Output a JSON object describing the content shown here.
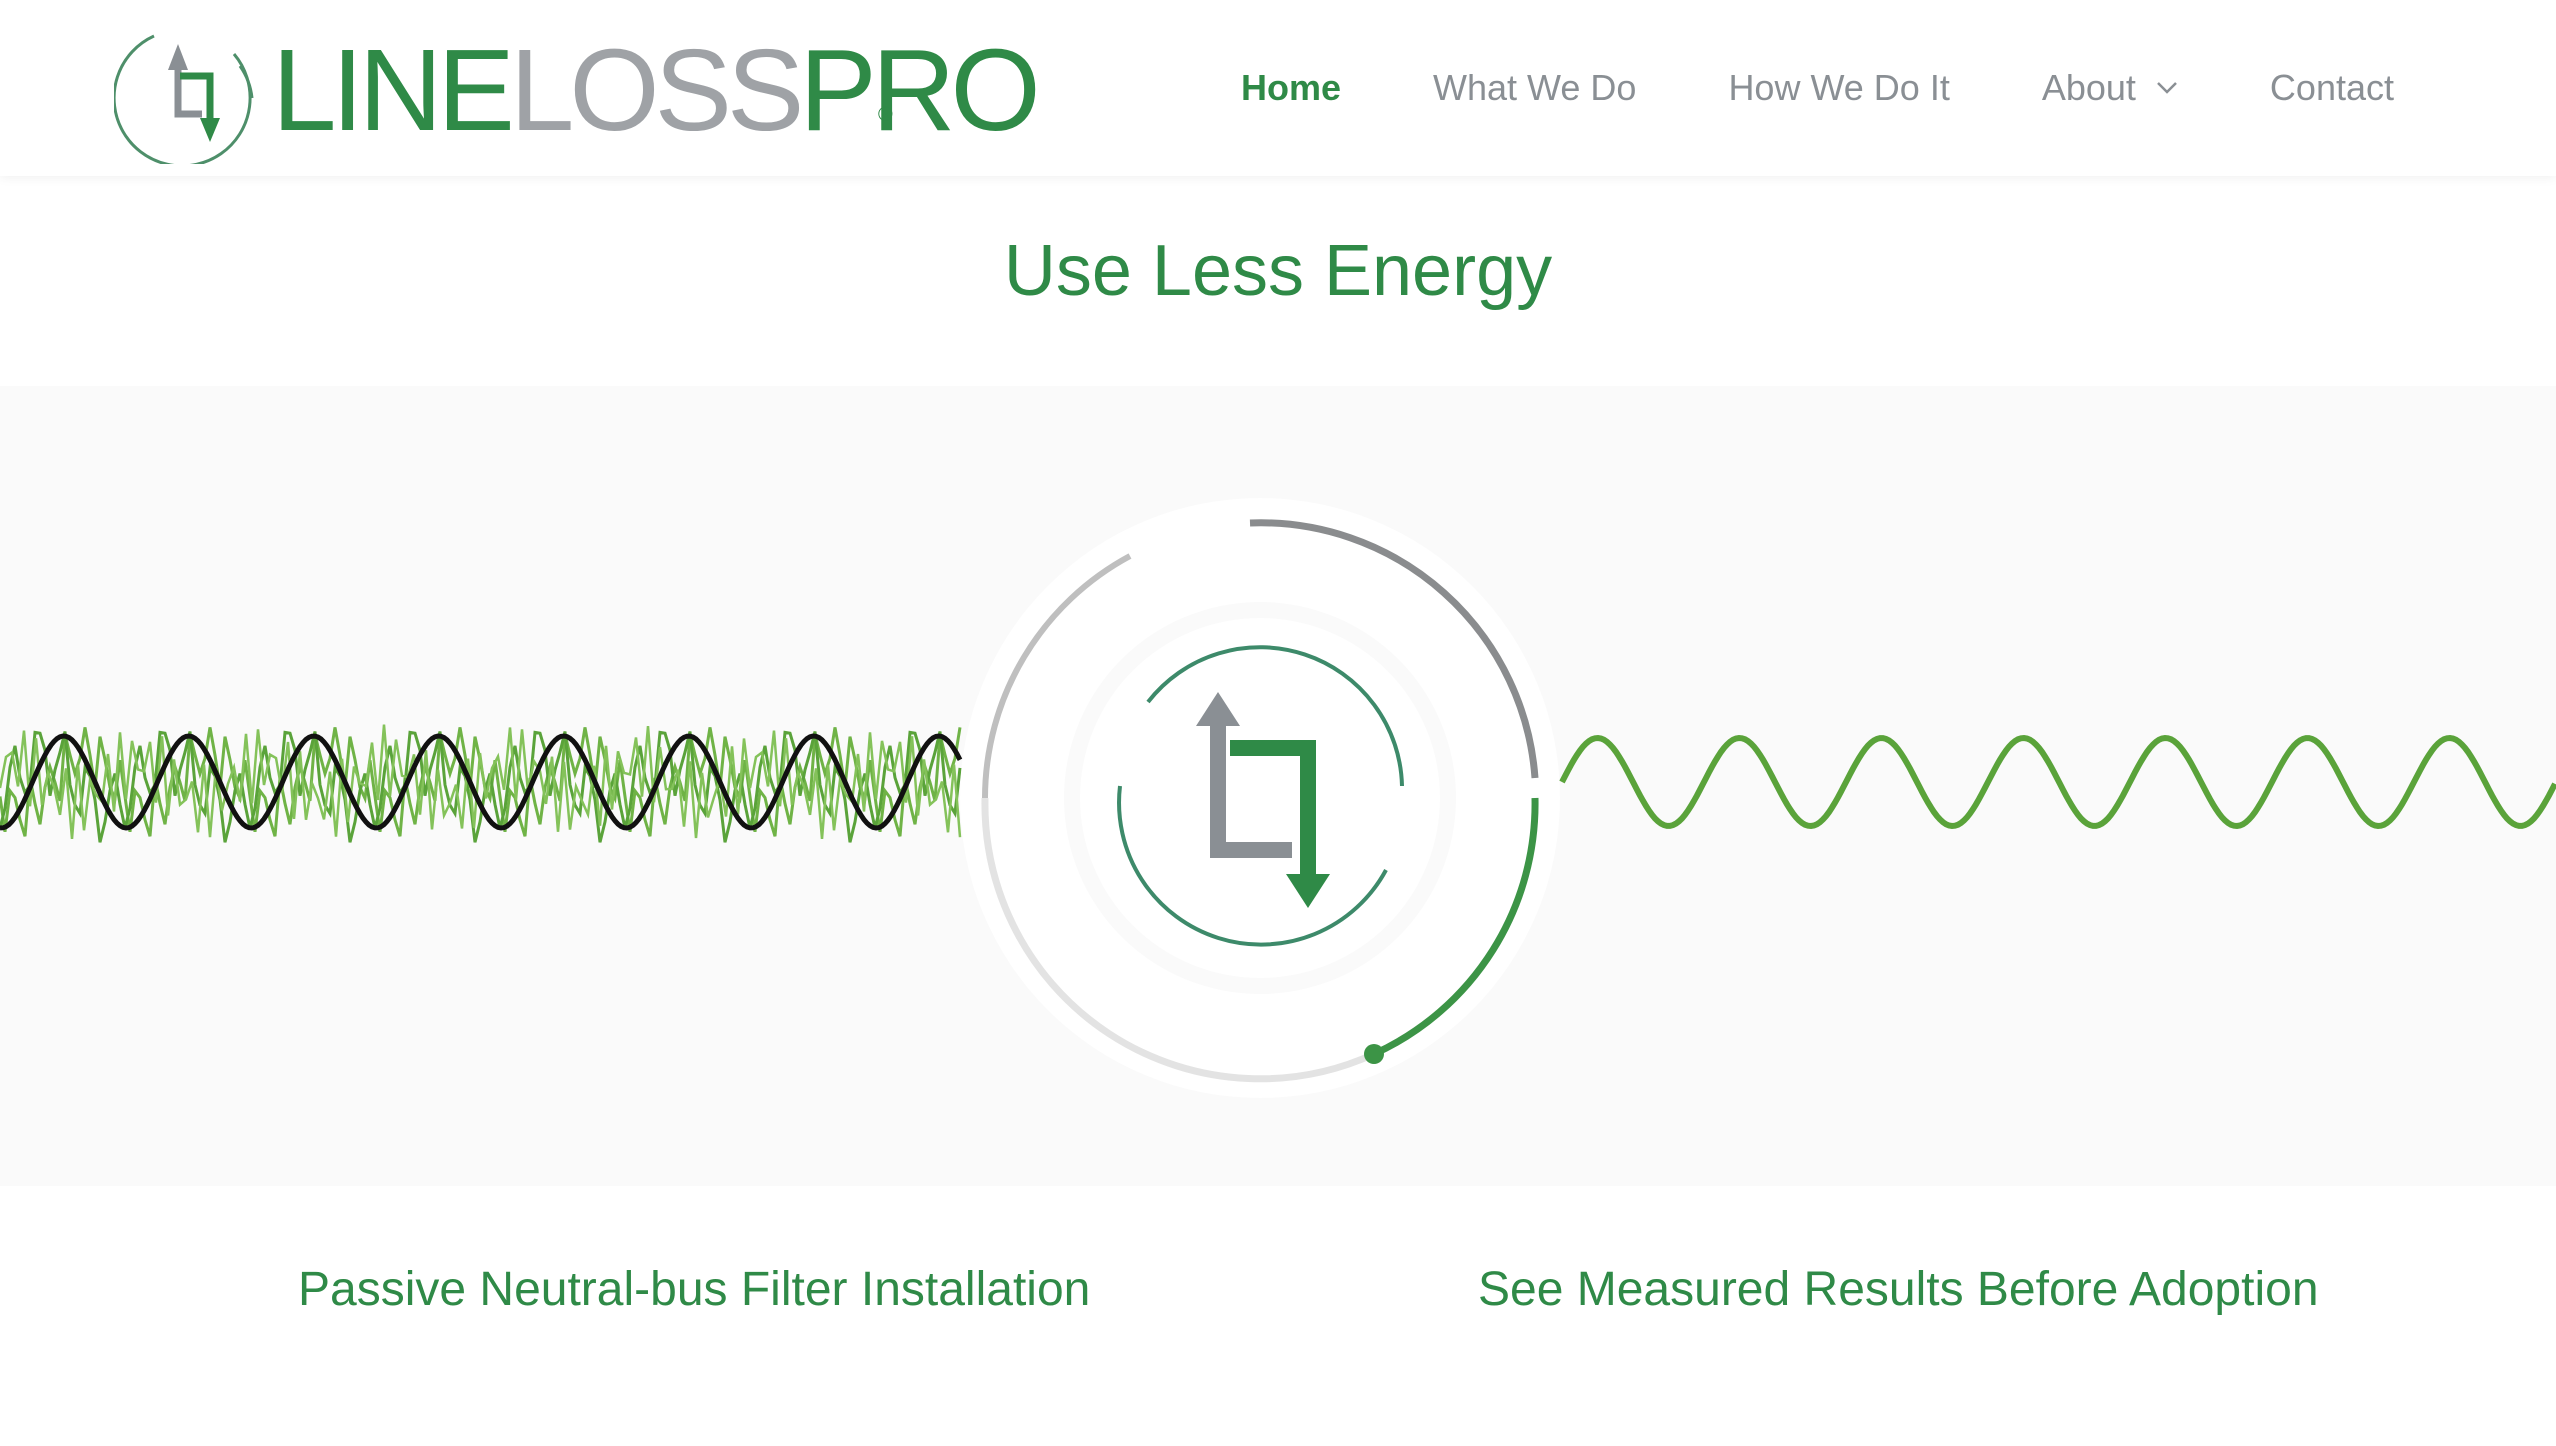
{
  "brand": {
    "name_part1": "LINE",
    "name_part2": "LOSS",
    "name_part3": "PRO",
    "registered_mark": "®"
  },
  "nav": {
    "items": [
      {
        "label": "Home",
        "active": true
      },
      {
        "label": "What We Do",
        "active": false
      },
      {
        "label": "How We Do It",
        "active": false
      },
      {
        "label": "About",
        "active": false,
        "has_dropdown": true
      },
      {
        "label": "Contact",
        "active": false
      }
    ]
  },
  "hero": {
    "headline": "Use Less Energy",
    "center_icon": "swap-arrows-icon",
    "left_graphic": "distorted-waveform",
    "right_graphic": "clean-sine-wave"
  },
  "features": [
    {
      "title": "Passive Neutral-bus Filter Installation"
    },
    {
      "title": "See Measured Results Before Adoption"
    }
  ],
  "colors": {
    "brand_green": "#2f8a47",
    "wave_green": "#5aa33a",
    "gray": "#9fa2a6",
    "hero_background": "#fafafa"
  }
}
